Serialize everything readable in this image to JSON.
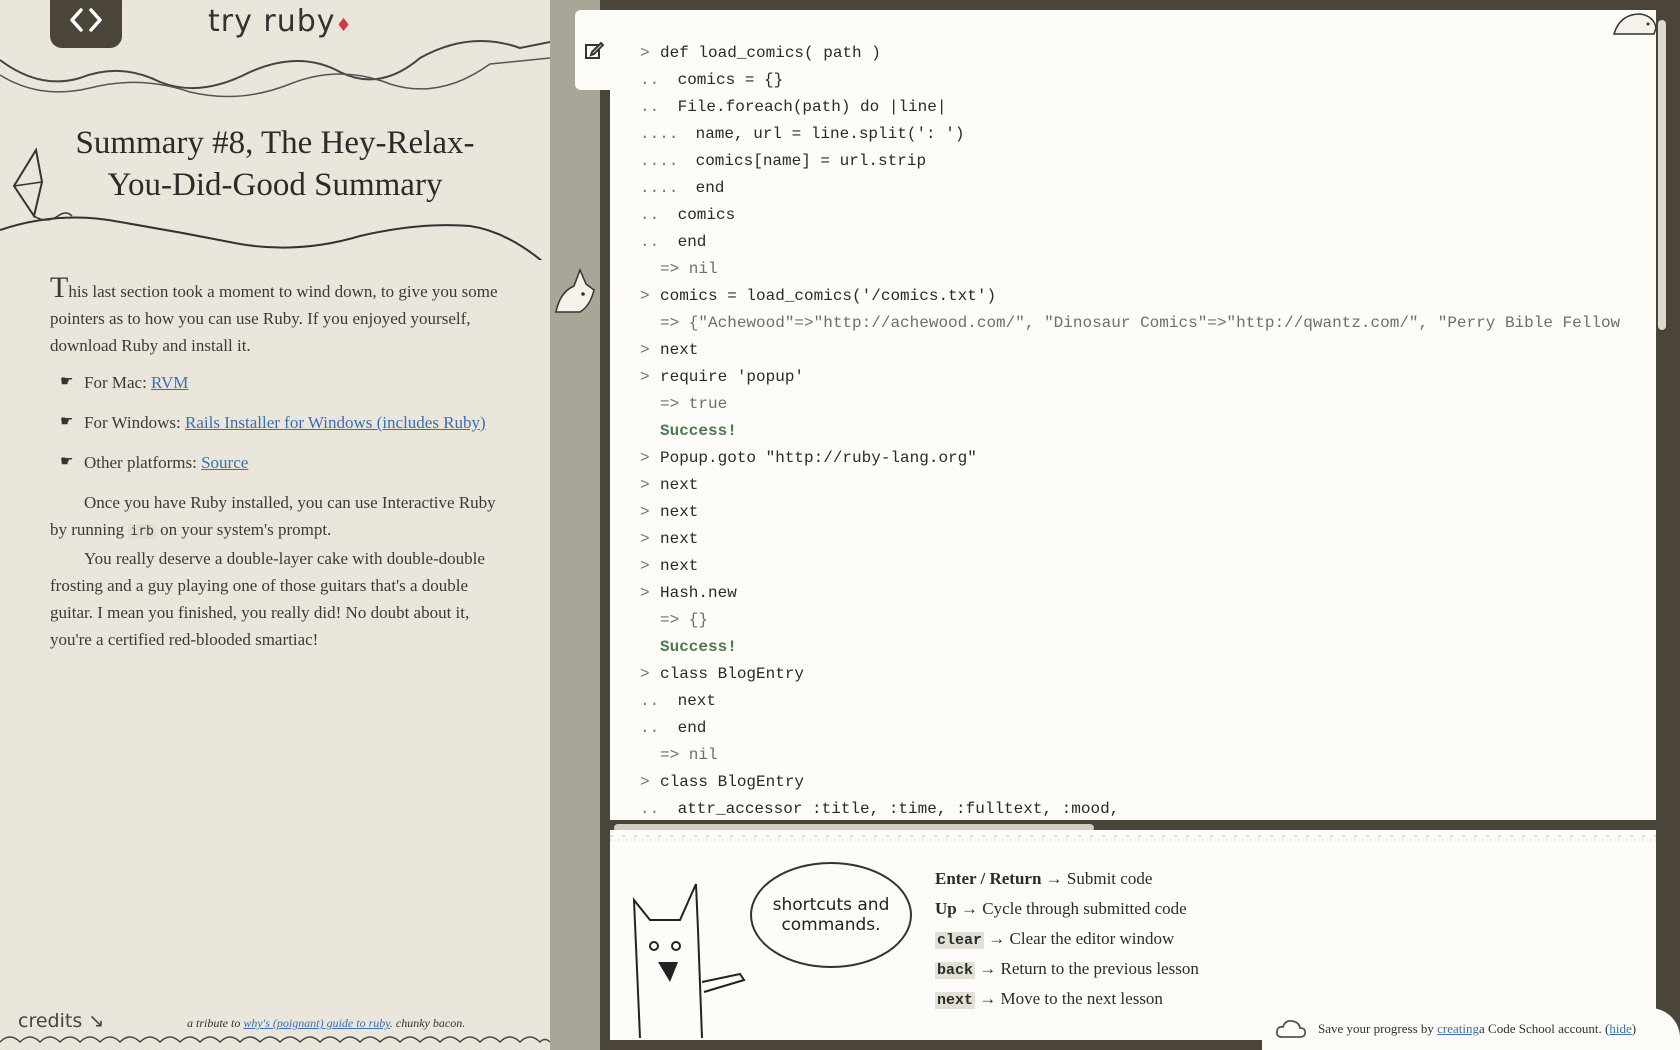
{
  "brand": {
    "name": "try ruby",
    "gem": "♦"
  },
  "lesson": {
    "title": "Summary #8, The Hey-Relax-You-Did-Good Summary",
    "intro_first_letter": "T",
    "intro_rest": "his last section took a moment to wind down, to give you some pointers as to how you can use Ruby. If you enjoyed yourself, download Ruby and install it.",
    "downloads": [
      {
        "label": "For Mac: ",
        "link": "RVM"
      },
      {
        "label": "For Windows: ",
        "link": "Rails Installer for Windows (includes Ruby)"
      },
      {
        "label": "Other platforms: ",
        "link": "Source"
      }
    ],
    "irb_before": "Once you have Ruby installed, you can use Interactive Ruby by running ",
    "irb_code": "irb",
    "irb_after": " on your system's prompt.",
    "cake": "You really deserve a double-layer cake with double-double frosting and a guy playing one of those guitars that's a double guitar. I mean you finished, you really did! No doubt about it, you're a certified red-blooded smartiac!"
  },
  "footer": {
    "credits": "credits ↘",
    "tribute_prefix": "a tribute to ",
    "tribute_link": "why's (poignant) guide to ruby",
    "tribute_suffix": ". chunky bacon."
  },
  "console": [
    {
      "prompt": ">",
      "text": "def load_comics( path )",
      "kind": "input"
    },
    {
      "prompt": "..",
      "text": " comics = {}",
      "kind": "input"
    },
    {
      "prompt": "..",
      "text": " File.foreach(path) do |line|",
      "kind": "input"
    },
    {
      "prompt": "....",
      "text": " name, url = line.split(': ')",
      "kind": "input"
    },
    {
      "prompt": "....",
      "text": " comics[name] = url.strip",
      "kind": "input"
    },
    {
      "prompt": "....",
      "text": " end",
      "kind": "input"
    },
    {
      "prompt": "..",
      "text": " comics",
      "kind": "input"
    },
    {
      "prompt": "..",
      "text": " end",
      "kind": "input"
    },
    {
      "prompt": "",
      "text": "=> nil",
      "kind": "result"
    },
    {
      "prompt": ">",
      "text": "comics = load_comics('/comics.txt')",
      "kind": "input"
    },
    {
      "prompt": "",
      "text": "=> {\"Achewood\"=>\"http://achewood.com/\", \"Dinosaur Comics\"=>\"http://qwantz.com/\", \"Perry Bible Fellow",
      "kind": "result"
    },
    {
      "prompt": ">",
      "text": "next",
      "kind": "input"
    },
    {
      "prompt": ">",
      "text": "require 'popup'",
      "kind": "input"
    },
    {
      "prompt": "",
      "text": "=> true",
      "kind": "result"
    },
    {
      "prompt": "",
      "text": "Success!",
      "kind": "success"
    },
    {
      "prompt": ">",
      "text": "Popup.goto \"http://ruby-lang.org\"",
      "kind": "input"
    },
    {
      "prompt": ">",
      "text": "next",
      "kind": "input"
    },
    {
      "prompt": ">",
      "text": "next",
      "kind": "input"
    },
    {
      "prompt": ">",
      "text": "next",
      "kind": "input"
    },
    {
      "prompt": ">",
      "text": "next",
      "kind": "input"
    },
    {
      "prompt": ">",
      "text": "Hash.new",
      "kind": "input"
    },
    {
      "prompt": "",
      "text": "=> {}",
      "kind": "result"
    },
    {
      "prompt": "",
      "text": "Success!",
      "kind": "success"
    },
    {
      "prompt": ">",
      "text": "class BlogEntry",
      "kind": "input"
    },
    {
      "prompt": "..",
      "text": " next",
      "kind": "input"
    },
    {
      "prompt": "..",
      "text": " end",
      "kind": "input"
    },
    {
      "prompt": "",
      "text": "=> nil",
      "kind": "result"
    },
    {
      "prompt": ">",
      "text": "class BlogEntry",
      "kind": "input"
    },
    {
      "prompt": "..",
      "text": " attr_accessor :title, :time, :fulltext, :mood,",
      "kind": "input"
    }
  ],
  "bubble": "shortcuts and commands.",
  "shortcuts": [
    {
      "key": "Enter / Return",
      "is_code": false,
      "desc": "Submit code"
    },
    {
      "key": "Up",
      "is_code": false,
      "desc": "Cycle through submitted code"
    },
    {
      "key": "clear",
      "is_code": true,
      "desc": "Clear the editor window"
    },
    {
      "key": "back",
      "is_code": true,
      "desc": "Return to the previous lesson"
    },
    {
      "key": "next",
      "is_code": true,
      "desc": "Move to the next lesson"
    }
  ],
  "save": {
    "prefix": "Save your progress by ",
    "link": "creating",
    "middle": " a Code School account. (",
    "hide": "hide",
    "suffix": ")"
  },
  "colors": {
    "success": "#4c7a52",
    "link": "#3a6fb0",
    "frame": "#4a4538",
    "paper": "#ebe7dc"
  }
}
